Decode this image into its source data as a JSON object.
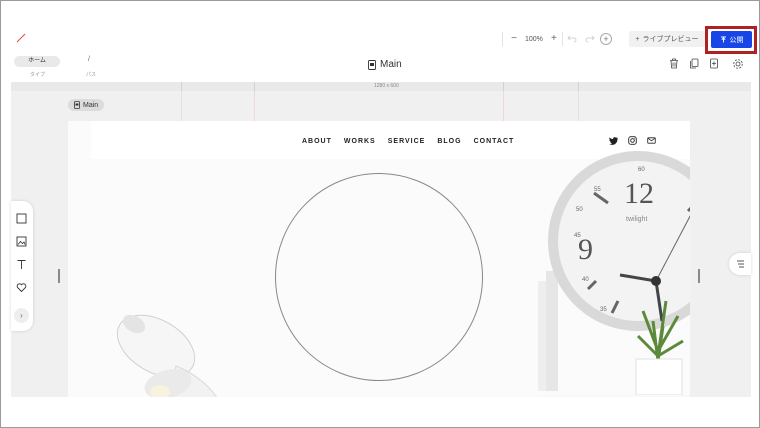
{
  "toolbar": {
    "zoom_out": "−",
    "zoom_level": "100%",
    "zoom_in": "+",
    "undo_icon": "undo-icon",
    "redo_icon": "redo-icon",
    "add_icon": "plus-circle-icon",
    "live_preview_label": "ライブプレビュー",
    "publish_label": "公開",
    "accent_color": "#1745e8",
    "highlight_color": "#b02222"
  },
  "subbar": {
    "home_label": "ホーム",
    "type_caption": "タイプ",
    "path_value": "/",
    "path_caption": "パス",
    "page_title": "Main"
  },
  "ruler": {
    "size_label": "1280 x 600"
  },
  "canvas": {
    "section_tag": "Main"
  },
  "site": {
    "nav": [
      "ABOUT",
      "WORKS",
      "SERVICE",
      "BLOG",
      "CONTACT"
    ],
    "social_icons": [
      "twitter-icon",
      "instagram-icon",
      "mail-icon"
    ],
    "clock_numbers": [
      "12",
      "9",
      "45",
      "40",
      "60",
      "55",
      "50",
      "35"
    ],
    "clock_brand": "twilight"
  },
  "left_tools": [
    "square-icon",
    "image-icon",
    "text-icon",
    "heart-icon"
  ],
  "left_expand": "›"
}
